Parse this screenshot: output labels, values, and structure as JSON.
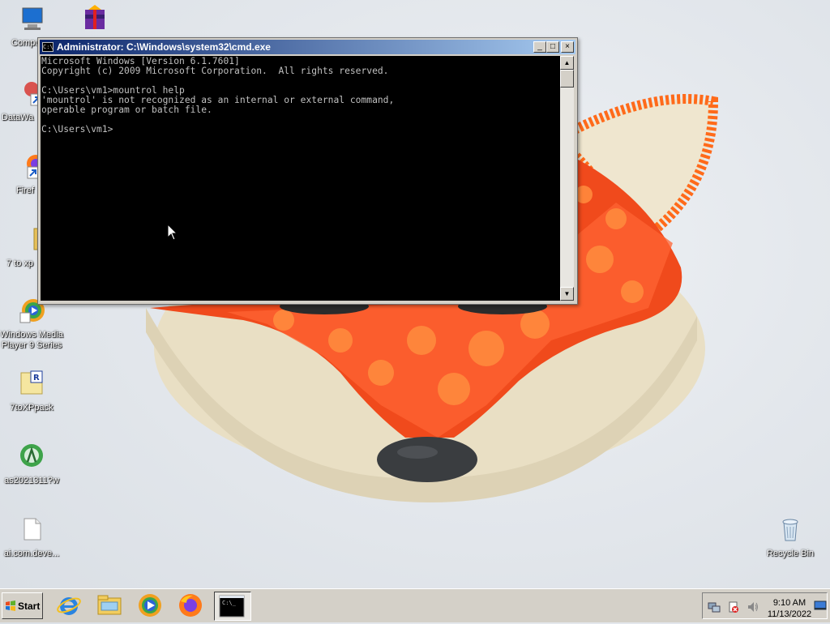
{
  "desktop": {
    "icons": [
      {
        "label": "Compu",
        "icon": "computer-icon"
      },
      {
        "label": "",
        "icon": "winrar-archive-icon"
      },
      {
        "label": "DataWa",
        "icon": "datawarrior-shortcut-icon"
      },
      {
        "label": "Firef",
        "icon": "firefox-shortcut-icon"
      },
      {
        "label": "7 to xp",
        "icon": "folder-icon"
      },
      {
        "label": "Windows Media Player 9 Series",
        "icon": "windows-media-player-icon"
      },
      {
        "label": "7toXPpack",
        "icon": "7toxppack-icon"
      },
      {
        "label": "as2021311?w",
        "icon": "android-studio-icon"
      },
      {
        "label": "ai.com.deve...",
        "icon": "document-icon"
      },
      {
        "label": "Recycle Bin",
        "icon": "recycle-bin-icon"
      }
    ]
  },
  "cmd_window": {
    "title": "Administrator: C:\\Windows\\system32\\cmd.exe",
    "icon": "cmd-icon",
    "minimize_label": "_",
    "maximize_label": "□",
    "close_label": "×",
    "console_text": "Microsoft Windows [Version 6.1.7601]\nCopyright (c) 2009 Microsoft Corporation.  All rights reserved.\n\nC:\\Users\\vm1>mountrol help\n'mountrol' is not recognized as an internal or external command,\noperable program or batch file.\n\nC:\\Users\\vm1>",
    "scroll_up_label": "▲",
    "scroll_down_label": "▼"
  },
  "taskbar": {
    "start_label": "Start",
    "apps": [
      {
        "name": "internet-explorer-icon",
        "active": false
      },
      {
        "name": "windows-explorer-icon",
        "active": false
      },
      {
        "name": "media-player-icon",
        "active": false
      },
      {
        "name": "firefox-icon",
        "active": false
      },
      {
        "name": "cmd-icon",
        "active": true
      }
    ],
    "tray": {
      "time": "9:10 AM",
      "date": "11/13/2022",
      "icons": [
        "network-icon",
        "action-center-icon",
        "volume-icon",
        "show-desktop-icon"
      ]
    }
  },
  "colors": {
    "titlebar_start": "#0a246a",
    "titlebar_end": "#a6caf0",
    "console_bg": "#000000",
    "console_fg": "#c0c0c0"
  }
}
